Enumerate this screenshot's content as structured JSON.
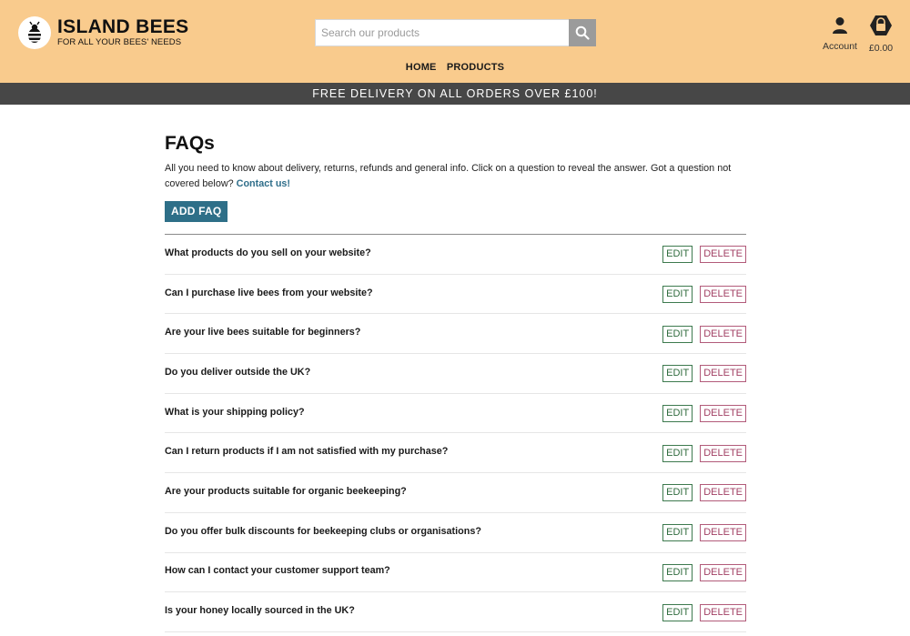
{
  "header": {
    "brand": "ISLAND BEES",
    "tagline": "FOR ALL YOUR BEES' NEEDS",
    "search_placeholder": "Search our products",
    "account_label": "Account",
    "bag_total": "£0.00"
  },
  "nav": {
    "home": "HOME",
    "products": "PRODUCTS"
  },
  "banner": {
    "text": "FREE DELIVERY ON ALL ORDERS OVER £100!"
  },
  "page": {
    "title": "FAQs",
    "intro": "All you need to know about delivery, returns, refunds and general info. Click on a question to reveal the answer. Got a question not covered below?",
    "contact_link": "Contact us!",
    "add_button": "ADD FAQ",
    "edit_label": "EDIT",
    "delete_label": "DELETE"
  },
  "faqs": [
    "What products do you sell on your website?",
    "Can I purchase live bees from your website?",
    "Are your live bees suitable for beginners?",
    "Do you deliver outside the UK?",
    "What is your shipping policy?",
    "Can I return products if I am not satisfied with my purchase?",
    "Are your products suitable for organic beekeeping?",
    "Do you offer bulk discounts for beekeeping clubs or organisations?",
    "How can I contact your customer support team?",
    "Is your honey locally sourced in the UK?"
  ],
  "colors": {
    "header_bg": "#f9cb8d",
    "banner_bg": "#474747",
    "accent": "#2e6f88",
    "edit": "#2f6b3d",
    "delete": "#a13f63"
  },
  "icons": {
    "logo": "bee-icon",
    "search": "search-icon",
    "account": "user-icon",
    "bag": "shopping-bag-icon"
  }
}
